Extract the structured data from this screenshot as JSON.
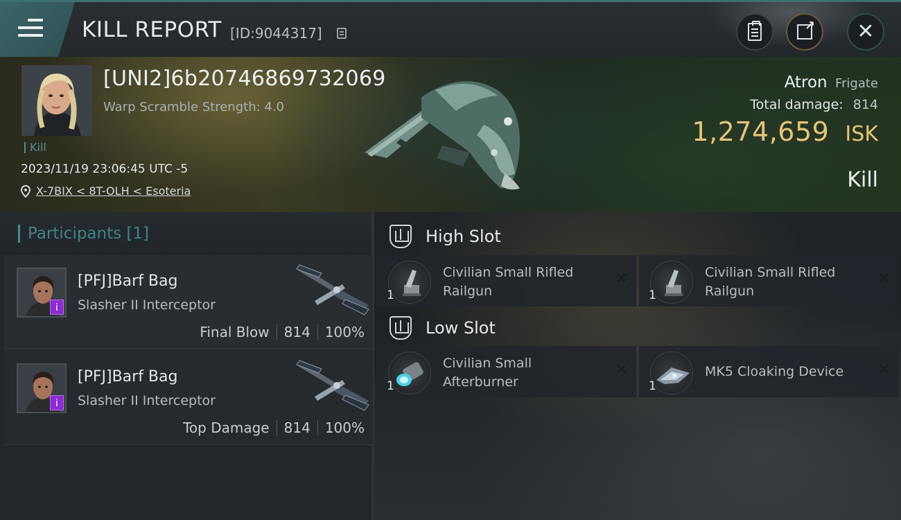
{
  "header": {
    "title": "KILL REPORT",
    "report_id": "[ID:9044317]"
  },
  "victim": {
    "name": "[UNI2]6b20746869732069",
    "warp_scramble": "Warp Scramble Strength: 4.0",
    "tag": "Kill",
    "datetime": "2023/11/19 23:06:45 UTC -5",
    "location": "X-7BIX < 8T-OLH < Esoteria",
    "ship_name": "Atron",
    "ship_class": "Frigate",
    "total_damage_label": "Total damage:",
    "total_damage": "814",
    "isk_value": "1,274,659",
    "isk_unit": "ISK",
    "result": "Kill"
  },
  "participants": {
    "title": "Participants [1]",
    "rows": [
      {
        "name": "[PFJ]Barf Bag",
        "ship": "Slasher II Interceptor",
        "role": "Final Blow",
        "damage": "814",
        "percent": "100%",
        "badge": "i"
      },
      {
        "name": "[PFJ]Barf Bag",
        "ship": "Slasher II Interceptor",
        "role": "Top Damage",
        "damage": "814",
        "percent": "100%",
        "badge": "i"
      }
    ]
  },
  "fitting": {
    "high_slot_label": "High Slot",
    "low_slot_label": "Low Slot",
    "high": [
      {
        "name": "Civilian Small Rifled Railgun",
        "qty": "1",
        "icon": "railgun-icon"
      },
      {
        "name": "Civilian Small Rifled Railgun",
        "qty": "1",
        "icon": "railgun-icon"
      }
    ],
    "low": [
      {
        "name": "Civilian Small Afterburner",
        "qty": "1",
        "icon": "afterburner-icon"
      },
      {
        "name": "MK5 Cloaking Device",
        "qty": "1",
        "icon": "cloaking-device-icon"
      }
    ],
    "dropped_mark": "✕"
  },
  "colors": {
    "accent_teal": "#3f8486",
    "isk_gold": "#e7c479",
    "badge_purple": "#8d2bd1"
  }
}
